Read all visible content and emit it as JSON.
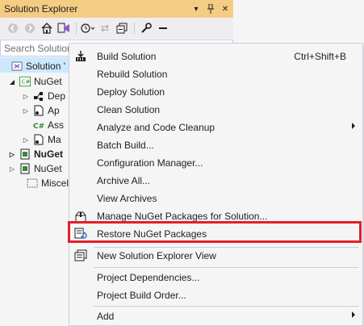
{
  "panel": {
    "title": "Solution Explorer",
    "pin_glyph": "▾",
    "search_placeholder": "Search Solution"
  },
  "tree": [
    {
      "label": "Solution '",
      "icon": "solution-icon"
    },
    {
      "label": "NuGet",
      "icon": "csharp-project-icon"
    },
    {
      "label": "Dep",
      "icon": "dependencies-icon"
    },
    {
      "label": "Ap",
      "icon": "file-icon"
    },
    {
      "label": "Ass",
      "icon": "csharp-file-icon"
    },
    {
      "label": "Ma",
      "icon": "file-icon"
    },
    {
      "label": "NuGet",
      "icon": "project-icon"
    },
    {
      "label": "NuGet",
      "icon": "project-icon"
    },
    {
      "label": "Miscel",
      "icon": "misc-files-icon"
    }
  ],
  "menu": {
    "items": [
      {
        "label": "Build Solution",
        "shortcut": "Ctrl+Shift+B"
      },
      {
        "label": "Rebuild Solution"
      },
      {
        "label": "Deploy Solution"
      },
      {
        "label": "Clean Solution"
      },
      {
        "label": "Analyze and Code Cleanup"
      },
      {
        "label": "Batch Build..."
      },
      {
        "label": "Configuration Manager..."
      },
      {
        "label": "Archive All..."
      },
      {
        "label": "View Archives"
      },
      {
        "label": "Manage NuGet Packages for Solution..."
      },
      {
        "label": "Restore NuGet Packages"
      },
      {
        "label": "New Solution Explorer View"
      },
      {
        "label": "Project Dependencies..."
      },
      {
        "label": "Project Build Order..."
      },
      {
        "label": "Add"
      }
    ]
  },
  "colors": {
    "title_bar": "#f5cc84",
    "selection": "#cce8ff",
    "highlight_box": "#e0202a"
  }
}
